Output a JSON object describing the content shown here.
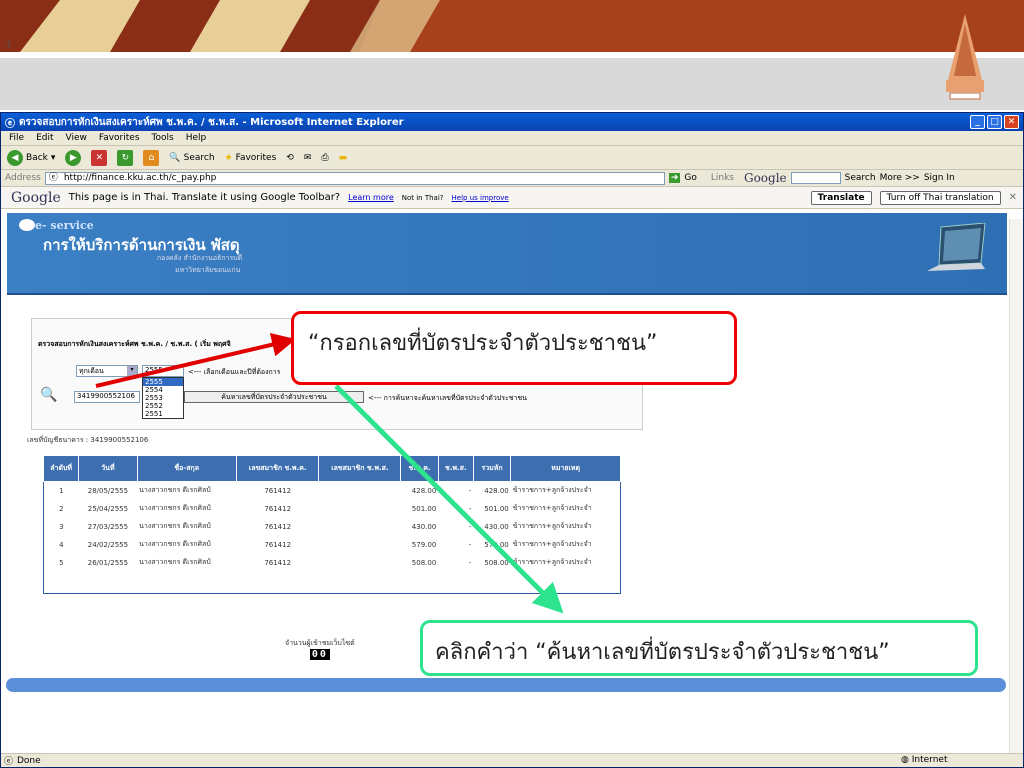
{
  "slide": {
    "number": "1"
  },
  "ie": {
    "title": "ตรวจสอบการหักเงินสงเคราะห์ศพ ช.พ.ค. / ช.พ.ส. - Microsoft Internet Explorer",
    "menu": [
      "File",
      "Edit",
      "View",
      "Favorites",
      "Tools",
      "Help"
    ],
    "toolbar": {
      "back": "Back",
      "search": "Search",
      "favorites": "Favorites"
    },
    "address_label": "Address",
    "address_value": "http://finance.kku.ac.th/c_pay.php",
    "go": "Go",
    "links": "Links",
    "right_tools": {
      "google": "Google",
      "search": "Search",
      "more": "More >>",
      "signin": "Sign In"
    },
    "status": "Done",
    "zone": "Internet"
  },
  "gbar": {
    "logo": "Google",
    "message": "This page is in Thai.  Translate it using Google Toolbar?",
    "learn_more": "Learn more",
    "not_thai": "Not in Thai?",
    "help": "Help us improve",
    "translate_btn": "Translate",
    "turn_off_btn": "Turn off Thai translation"
  },
  "site": {
    "eservice": "e- service",
    "title": "การให้บริการด้านการเงิน พัสดุ",
    "sub1": "กองคลัง สำนักงานอธิการบดี",
    "sub2": "มหาวิทยาลัยขอนแก่น"
  },
  "panel": {
    "heading": "ตรวจสอบการหักเงินสงเคราะห์ศพ ช.พ.ค. / ช.พ.ส. ( เริ่ม พฤศจิ",
    "month_select": "ทุกเดือน",
    "year_select": "2555",
    "year_options": [
      "2555",
      "2554",
      "2553",
      "2552",
      "2551"
    ],
    "select_hint": "<--- เลือกเดือนและปีที่ต้องการ",
    "id_value": "3419900552106",
    "search_btn": "ค้นหาเลขที่บัตรประจำตัวประชาชน",
    "search_hint": "<--- การค้นหาจะค้นหาเลขที่บัตรประจำตัวประชาชน"
  },
  "account": "เลขที่บัญชีธนาคาร : 3419900552106",
  "table": {
    "headers": [
      "ลำดับที่",
      "วันที่",
      "ชื่อ-สกุล",
      "เลขสมาชิก ช.พ.ค.",
      "เลขสมาชิก ช.พ.ส.",
      "ช.พ.ค.",
      "ช.พ.ส.",
      "รวมหัก",
      "หมายเหตุ"
    ],
    "rows": [
      [
        "1",
        "28/05/2555",
        "นางสาวกชกร ดีเรกศิลป์",
        "761412",
        "",
        "428.00",
        "-",
        "428.00",
        "ข้าราชการ+ลูกจ้างประจำ"
      ],
      [
        "2",
        "25/04/2555",
        "นางสาวกชกร ดีเรกศิลป์",
        "761412",
        "",
        "501.00",
        "-",
        "501.00",
        "ข้าราชการ+ลูกจ้างประจำ"
      ],
      [
        "3",
        "27/03/2555",
        "นางสาวกชกร ดีเรกศิลป์",
        "761412",
        "",
        "430.00",
        "-",
        "430.00",
        "ข้าราชการ+ลูกจ้างประจำ"
      ],
      [
        "4",
        "24/02/2555",
        "นางสาวกชกร ดีเรกศิลป์",
        "761412",
        "",
        "579.00",
        "-",
        "579.00",
        "ข้าราชการ+ลูกจ้างประจำ"
      ],
      [
        "5",
        "26/01/2555",
        "นางสาวกชกร ดีเรกศิลป์",
        "761412",
        "",
        "508.00",
        "-",
        "508.00",
        "ข้าราชการ+ลูกจ้างประจำ"
      ]
    ]
  },
  "counter": {
    "label": "จำนวนผู้เข้าชมเว็บไซต์",
    "value": "00"
  },
  "callouts": {
    "red": "“กรอกเลขที่บัตรประจำตัวประชาชน”",
    "green": "คลิกคำว่า “ค้นหาเลขที่บัตรประจำตัวประชาชน”"
  },
  "colors": {
    "red": "#e00000",
    "green": "#2ee38e",
    "ie_blue": "#0a5fd8",
    "header_blue": "#3b7fc4"
  }
}
